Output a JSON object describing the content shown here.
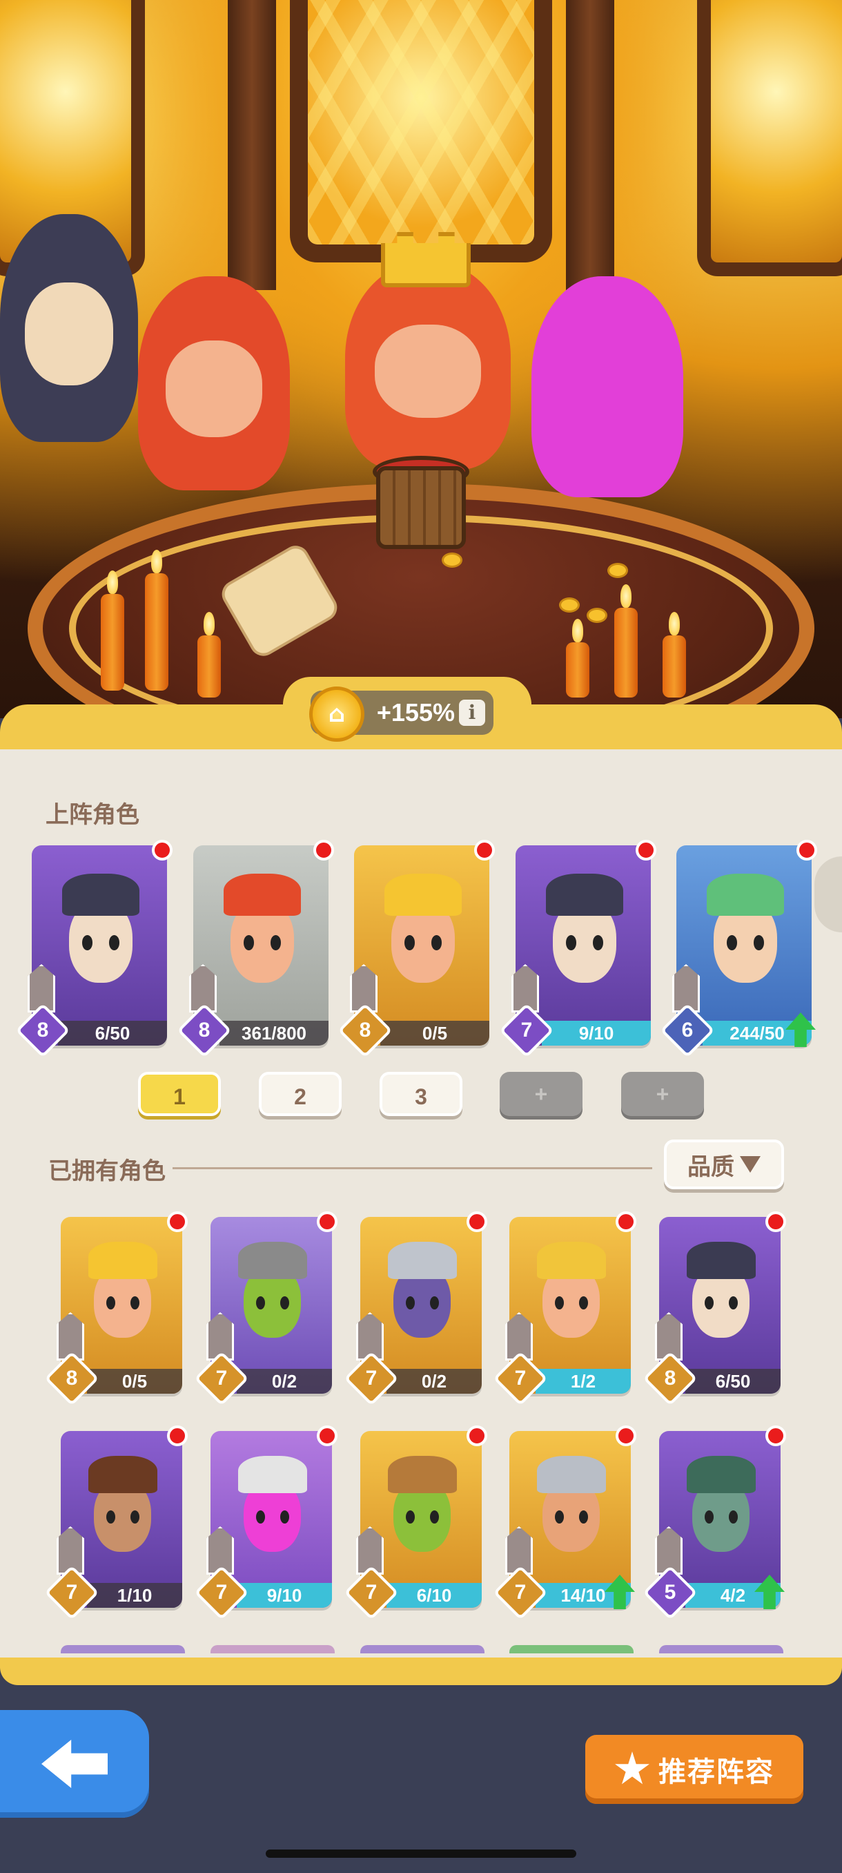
{
  "bonus": {
    "text": "+155%",
    "info_icon": "info-icon"
  },
  "lineup": {
    "title": "上阵角色",
    "cards": [
      {
        "progress": "6/50",
        "level": "8",
        "theme": "purple",
        "has_dot": true
      },
      {
        "progress": "361/800",
        "level": "8",
        "theme": "gray",
        "has_dot": true
      },
      {
        "progress": "0/5",
        "level": "8",
        "theme": "gold",
        "has_dot": true
      },
      {
        "progress": "9/10",
        "level": "7",
        "theme": "purple",
        "has_dot": true,
        "cyan": true
      },
      {
        "progress": "244/50",
        "level": "6",
        "theme": "blue",
        "has_dot": true,
        "cyan": true,
        "upgrade": true
      }
    ],
    "tabs": [
      "1",
      "2",
      "3",
      "+",
      "+"
    ]
  },
  "owned": {
    "title": "已拥有角色",
    "sort_label": "品质",
    "cards": [
      {
        "progress": "0/5",
        "level": "8"
      },
      {
        "progress": "0/2",
        "level": "7"
      },
      {
        "progress": "0/2",
        "level": "7"
      },
      {
        "progress": "1/2",
        "level": "7",
        "cyan": true
      },
      {
        "progress": "6/50",
        "level": "8"
      },
      {
        "progress": "1/10",
        "level": "7"
      },
      {
        "progress": "9/10",
        "level": "7",
        "cyan": true
      },
      {
        "progress": "6/10",
        "level": "7",
        "cyan": true
      },
      {
        "progress": "14/10",
        "level": "7",
        "cyan": true,
        "upgrade": true
      },
      {
        "progress": "4/2",
        "level": "5",
        "cyan": true,
        "upgrade": true
      }
    ]
  },
  "footer": {
    "back_icon": "back-arrow-icon",
    "recommend_label": "推荐阵容",
    "recommend_icon": "star-icon"
  },
  "colors": {
    "panel": "#ece7dd",
    "gold_band": "#f2c94c",
    "orange_button": "#f28a24",
    "blue_button": "#3a8ce8"
  }
}
